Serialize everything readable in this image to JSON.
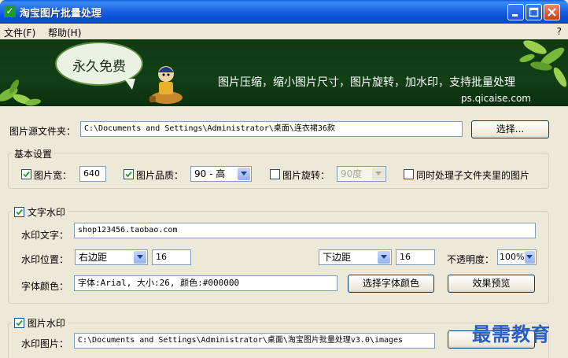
{
  "window": {
    "title": "淘宝图片批量处理"
  },
  "menu": {
    "file": "文件(F)",
    "help": "帮助(H)",
    "help_question": "?"
  },
  "banner": {
    "bubble_text": "永久免费",
    "slogan": "图片压缩，缩小图片尺寸，图片旋转，加水印，支持批量处理",
    "url": "ps.qicaise.com"
  },
  "source": {
    "label": "图片源文件夹：",
    "path": "C:\\Documents and Settings\\Administrator\\桌面\\连衣裙36款",
    "browse_label": "选择..."
  },
  "basic": {
    "group_title": "基本设置",
    "width_label": "图片宽：",
    "width_value": "640",
    "quality_label": "图片品质：",
    "quality_value": "90 - 高",
    "rotate_label": "图片旋转：",
    "rotate_value": "90度",
    "subfolder_label": "同时处理子文件夹里的图片",
    "width_checked": true,
    "quality_checked": true,
    "rotate_checked": false,
    "subfolder_checked": false
  },
  "text_watermark": {
    "group_title": "文字水印",
    "checked": true,
    "text_label": "水印文字：",
    "text_value": "shop123456.taobao.com",
    "position_label": "水印位置：",
    "h_position": "右边距",
    "h_margin": "16",
    "v_position": "下边距",
    "v_margin": "16",
    "opacity_label": "不透明度：",
    "opacity_value": "100%",
    "font_label": "字体颜色：",
    "font_value": "字体:Arial, 大小:26, 颜色:#000000",
    "choose_font_label": "选择字体颜色",
    "preview_label": "效果预览"
  },
  "image_watermark": {
    "group_title": "图片水印",
    "checked": true,
    "image_label": "水印图片：",
    "image_path": "C:\\Documents and Settings\\Administrator\\桌面\\淘宝图片批量处理v3.0\\images"
  },
  "overlay": {
    "watermark_text": "最需教育"
  },
  "colors": {
    "titlebar": "#1c64e6",
    "banner_bg": "#123f16",
    "window_bg": "#ece9d8",
    "watermark": "#2a5cc2"
  }
}
